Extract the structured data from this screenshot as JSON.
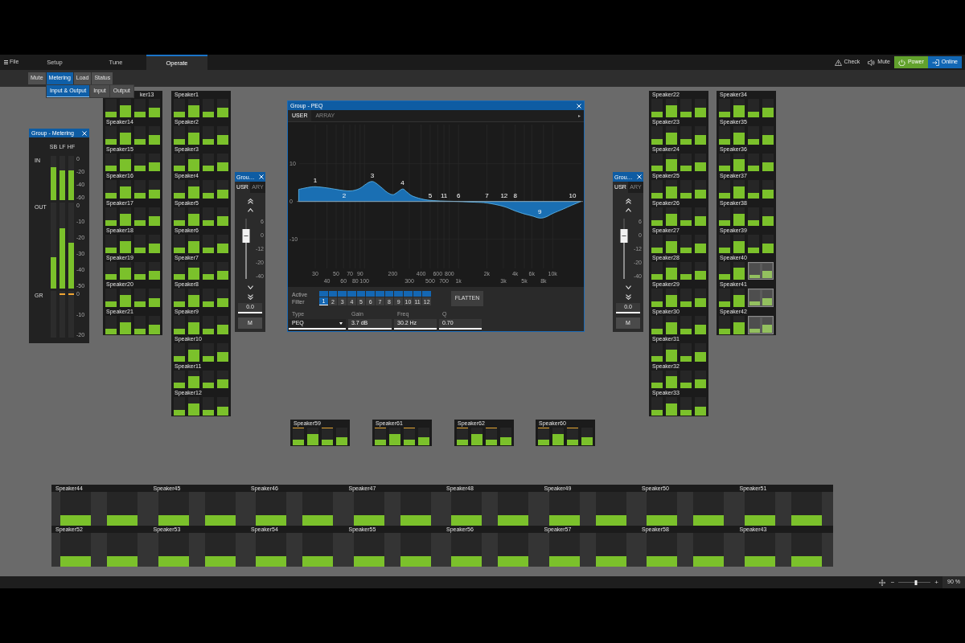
{
  "menu": {
    "file": "File",
    "tabs": [
      {
        "label": "Setup",
        "selected": false
      },
      {
        "label": "Tune",
        "selected": false
      },
      {
        "label": "Operate",
        "selected": true
      }
    ]
  },
  "top_actions": [
    {
      "kind": "check",
      "label": "Check",
      "on": false
    },
    {
      "kind": "mute",
      "label": "Mute",
      "on": false
    },
    {
      "kind": "power",
      "label": "Power",
      "on": true
    },
    {
      "kind": "online",
      "label": "Online",
      "on": true
    }
  ],
  "subtabs": [
    {
      "label": "Mute",
      "selected": false
    },
    {
      "label": "Metering",
      "selected": true
    },
    {
      "label": "Load",
      "selected": false
    },
    {
      "label": "Status",
      "selected": false
    }
  ],
  "submenu": [
    {
      "label": "Input & Output",
      "selected": true
    },
    {
      "label": "Input",
      "selected": false
    },
    {
      "label": "Output",
      "selected": false
    }
  ],
  "metering_window": {
    "title": "Group - Metering",
    "channels": [
      "SB",
      "LF",
      "HF"
    ],
    "rows": [
      {
        "label": "IN",
        "kind": "level",
        "scale": [
          "0",
          "-20",
          "-40",
          "-60"
        ],
        "meters": [
          {
            "level": 0.75
          },
          {
            "level": 0.67
          },
          {
            "level": 0.67
          }
        ]
      },
      {
        "label": "OUT",
        "kind": "level",
        "scale": [
          "0",
          "-10",
          "-20",
          "-30",
          "-40",
          "-50"
        ],
        "meters": [
          {
            "level": 0.36
          },
          {
            "level": 0.7
          },
          {
            "level": 0.53
          }
        ]
      },
      {
        "label": "GR",
        "kind": "reduction",
        "scale": [
          "0",
          "-10",
          "-20"
        ],
        "meters": [
          {
            "limiting": false
          },
          {
            "limiting": true
          },
          {
            "limiting": true
          }
        ]
      }
    ]
  },
  "speaker_groups": [
    {
      "kind": "column",
      "speakers": [
        {
          "name": "ker13",
          "meters": [
            {
              "level": 0.3
            },
            {
              "level": 0.65
            },
            {
              "level": 0.3
            },
            {
              "level": 0.5
            }
          ]
        },
        {
          "name": "Speaker14",
          "meters": [
            {
              "level": 0.3
            },
            {
              "level": 0.65
            },
            {
              "level": 0.3
            },
            {
              "level": 0.5
            }
          ]
        },
        {
          "name": "Speaker15",
          "meters": [
            {
              "level": 0.3
            },
            {
              "level": 0.65
            },
            {
              "level": 0.3
            },
            {
              "level": 0.5
            }
          ]
        },
        {
          "name": "Speaker16",
          "meters": [
            {
              "level": 0.3
            },
            {
              "level": 0.65
            },
            {
              "level": 0.3
            },
            {
              "level": 0.5
            }
          ]
        },
        {
          "name": "Speaker17",
          "meters": [
            {
              "level": 0.3
            },
            {
              "level": 0.65
            },
            {
              "level": 0.3
            },
            {
              "level": 0.5
            }
          ]
        },
        {
          "name": "Speaker18",
          "meters": [
            {
              "level": 0.3
            },
            {
              "level": 0.65
            },
            {
              "level": 0.3
            },
            {
              "level": 0.5
            }
          ]
        },
        {
          "name": "Speaker19",
          "meters": [
            {
              "level": 0.3
            },
            {
              "level": 0.65
            },
            {
              "level": 0.3
            },
            {
              "level": 0.5
            }
          ]
        },
        {
          "name": "Speaker20",
          "meters": [
            {
              "level": 0.3
            },
            {
              "level": 0.65
            },
            {
              "level": 0.3
            },
            {
              "level": 0.5
            }
          ]
        },
        {
          "name": "Speaker21",
          "meters": [
            {
              "level": 0.3
            },
            {
              "level": 0.65
            },
            {
              "level": 0.3
            },
            {
              "level": 0.5
            }
          ]
        }
      ]
    },
    {
      "kind": "column",
      "speakers": [
        {
          "name": "Speaker1",
          "meters": [
            {
              "level": 0.3
            },
            {
              "level": 0.65
            },
            {
              "level": 0.3
            },
            {
              "level": 0.5
            }
          ]
        },
        {
          "name": "Speaker2",
          "meters": [
            {
              "level": 0.3
            },
            {
              "level": 0.65
            },
            {
              "level": 0.3
            },
            {
              "level": 0.5
            }
          ]
        },
        {
          "name": "Speaker3",
          "meters": [
            {
              "level": 0.3
            },
            {
              "level": 0.65
            },
            {
              "level": 0.3
            },
            {
              "level": 0.5
            }
          ]
        },
        {
          "name": "Speaker4",
          "meters": [
            {
              "level": 0.3
            },
            {
              "level": 0.65
            },
            {
              "level": 0.3
            },
            {
              "level": 0.5
            }
          ]
        },
        {
          "name": "Speaker5",
          "meters": [
            {
              "level": 0.3
            },
            {
              "level": 0.65
            },
            {
              "level": 0.3
            },
            {
              "level": 0.5
            }
          ]
        },
        {
          "name": "Speaker6",
          "meters": [
            {
              "level": 0.3
            },
            {
              "level": 0.65
            },
            {
              "level": 0.3
            },
            {
              "level": 0.5
            }
          ]
        },
        {
          "name": "Speaker7",
          "meters": [
            {
              "level": 0.3
            },
            {
              "level": 0.65
            },
            {
              "level": 0.3
            },
            {
              "level": 0.5
            }
          ]
        },
        {
          "name": "Speaker8",
          "meters": [
            {
              "level": 0.3
            },
            {
              "level": 0.65
            },
            {
              "level": 0.3
            },
            {
              "level": 0.5
            }
          ]
        },
        {
          "name": "Speaker9",
          "meters": [
            {
              "level": 0.3
            },
            {
              "level": 0.65
            },
            {
              "level": 0.3
            },
            {
              "level": 0.5
            }
          ]
        },
        {
          "name": "Speaker10",
          "meters": [
            {
              "level": 0.3
            },
            {
              "level": 0.65
            },
            {
              "level": 0.3
            },
            {
              "level": 0.5
            }
          ]
        },
        {
          "name": "Speaker11",
          "meters": [
            {
              "level": 0.3
            },
            {
              "level": 0.65
            },
            {
              "level": 0.3
            },
            {
              "level": 0.5
            }
          ]
        },
        {
          "name": "Speaker12",
          "meters": [
            {
              "level": 0.3
            },
            {
              "level": 0.65
            },
            {
              "level": 0.3
            },
            {
              "level": 0.5
            }
          ]
        }
      ]
    },
    {
      "kind": "column",
      "speakers": [
        {
          "name": "Speaker22",
          "meters": [
            {
              "level": 0.3
            },
            {
              "level": 0.65
            },
            {
              "level": 0.3
            },
            {
              "level": 0.5
            }
          ]
        },
        {
          "name": "Speaker23",
          "meters": [
            {
              "level": 0.3
            },
            {
              "level": 0.65
            },
            {
              "level": 0.3
            },
            {
              "level": 0.5
            }
          ]
        },
        {
          "name": "Speaker24",
          "meters": [
            {
              "level": 0.3
            },
            {
              "level": 0.65
            },
            {
              "level": 0.3
            },
            {
              "level": 0.5
            }
          ]
        },
        {
          "name": "Speaker25",
          "meters": [
            {
              "level": 0.3
            },
            {
              "level": 0.65
            },
            {
              "level": 0.3
            },
            {
              "level": 0.5
            }
          ]
        },
        {
          "name": "Speaker26",
          "meters": [
            {
              "level": 0.3
            },
            {
              "level": 0.65
            },
            {
              "level": 0.3
            },
            {
              "level": 0.5
            }
          ]
        },
        {
          "name": "Speaker27",
          "meters": [
            {
              "level": 0.3
            },
            {
              "level": 0.65
            },
            {
              "level": 0.3
            },
            {
              "level": 0.5
            }
          ]
        },
        {
          "name": "Speaker28",
          "meters": [
            {
              "level": 0.3
            },
            {
              "level": 0.65
            },
            {
              "level": 0.3
            },
            {
              "level": 0.5
            }
          ]
        },
        {
          "name": "Speaker29",
          "meters": [
            {
              "level": 0.3
            },
            {
              "level": 0.65
            },
            {
              "level": 0.3
            },
            {
              "level": 0.5
            }
          ]
        },
        {
          "name": "Speaker30",
          "meters": [
            {
              "level": 0.3
            },
            {
              "level": 0.65
            },
            {
              "level": 0.3
            },
            {
              "level": 0.5
            }
          ]
        },
        {
          "name": "Speaker31",
          "meters": [
            {
              "level": 0.3
            },
            {
              "level": 0.65
            },
            {
              "level": 0.3
            },
            {
              "level": 0.5
            }
          ]
        },
        {
          "name": "Speaker32",
          "meters": [
            {
              "level": 0.3
            },
            {
              "level": 0.65
            },
            {
              "level": 0.3
            },
            {
              "level": 0.5
            }
          ]
        },
        {
          "name": "Speaker33",
          "meters": [
            {
              "level": 0.3
            },
            {
              "level": 0.65
            },
            {
              "level": 0.3
            },
            {
              "level": 0.5
            }
          ]
        }
      ]
    },
    {
      "kind": "column",
      "speakers": [
        {
          "name": "Speaker34",
          "kind": "standard",
          "meters": [
            {
              "level": 0.3
            },
            {
              "level": 0.65
            },
            {
              "level": 0.3
            },
            {
              "level": 0.5
            }
          ]
        },
        {
          "name": "Speaker35",
          "kind": "standard",
          "meters": [
            {
              "level": 0.3
            },
            {
              "level": 0.65
            },
            {
              "level": 0.3
            },
            {
              "level": 0.5
            }
          ]
        },
        {
          "name": "Speaker36",
          "kind": "standard",
          "meters": [
            {
              "level": 0.3
            },
            {
              "level": 0.65
            },
            {
              "level": 0.3
            },
            {
              "level": 0.5
            }
          ]
        },
        {
          "name": "Speaker37",
          "kind": "standard",
          "meters": [
            {
              "level": 0.3
            },
            {
              "level": 0.65
            },
            {
              "level": 0.3
            },
            {
              "level": 0.5
            }
          ]
        },
        {
          "name": "Speaker38",
          "kind": "standard",
          "meters": [
            {
              "level": 0.3
            },
            {
              "level": 0.65
            },
            {
              "level": 0.3
            },
            {
              "level": 0.5
            }
          ]
        },
        {
          "name": "Speaker39",
          "kind": "standard",
          "meters": [
            {
              "level": 0.3
            },
            {
              "level": 0.65
            },
            {
              "level": 0.3
            },
            {
              "level": 0.5
            }
          ]
        },
        {
          "name": "Speaker40",
          "kind": "split",
          "meters": [
            {
              "level": 0.3
            },
            {
              "level": 0.65
            },
            {
              "level": 0.25
            },
            {
              "level": 0.5
            }
          ]
        },
        {
          "name": "Speaker41",
          "kind": "split",
          "meters": [
            {
              "level": 0.3
            },
            {
              "level": 0.65
            },
            {
              "level": 0.25
            },
            {
              "level": 0.5
            }
          ]
        },
        {
          "name": "Speaker42",
          "kind": "split",
          "meters": [
            {
              "level": 0.3
            },
            {
              "level": 0.65
            },
            {
              "level": 0.25
            },
            {
              "level": 0.5
            }
          ]
        }
      ]
    },
    {
      "kind": "compact",
      "speakers": [
        {
          "name": "Speaker59",
          "meters": [
            {
              "level": 0.3,
              "peak": true
            },
            {
              "level": 0.65,
              "peak": false
            },
            {
              "level": 0.3,
              "peak": true
            },
            {
              "level": 0.45,
              "peak": false
            }
          ]
        }
      ]
    },
    {
      "kind": "compact",
      "speakers": [
        {
          "name": "Speaker61",
          "meters": [
            {
              "level": 0.3,
              "peak": true
            },
            {
              "level": 0.65,
              "peak": false
            },
            {
              "level": 0.3,
              "peak": true
            },
            {
              "level": 0.45,
              "peak": false
            }
          ]
        }
      ]
    },
    {
      "kind": "compact",
      "speakers": [
        {
          "name": "Speaker62",
          "meters": [
            {
              "level": 0.3,
              "peak": true
            },
            {
              "level": 0.65,
              "peak": false
            },
            {
              "level": 0.3,
              "peak": true
            },
            {
              "level": 0.45,
              "peak": false
            }
          ]
        }
      ]
    },
    {
      "kind": "compact",
      "speakers": [
        {
          "name": "Speaker60",
          "meters": [
            {
              "level": 0.3,
              "peak": true
            },
            {
              "level": 0.65,
              "peak": false
            },
            {
              "level": 0.3,
              "peak": true
            },
            {
              "level": 0.45,
              "peak": false
            }
          ]
        }
      ]
    },
    {
      "kind": "wide",
      "speakers": [
        {
          "name": "Speaker44",
          "meters": [
            {
              "level": 0.32
            },
            {
              "level": 0.32
            }
          ]
        },
        {
          "name": "Speaker45",
          "meters": [
            {
              "level": 0.32
            },
            {
              "level": 0.32
            }
          ]
        },
        {
          "name": "Speaker46",
          "meters": [
            {
              "level": 0.32
            },
            {
              "level": 0.32
            }
          ]
        },
        {
          "name": "Speaker47",
          "meters": [
            {
              "level": 0.32
            },
            {
              "level": 0.32
            }
          ]
        },
        {
          "name": "Speaker48",
          "meters": [
            {
              "level": 0.32
            },
            {
              "level": 0.32
            }
          ]
        },
        {
          "name": "Speaker49",
          "meters": [
            {
              "level": 0.32
            },
            {
              "level": 0.32
            }
          ]
        },
        {
          "name": "Speaker50",
          "meters": [
            {
              "level": 0.32
            },
            {
              "level": 0.32
            }
          ]
        },
        {
          "name": "Speaker51",
          "meters": [
            {
              "level": 0.32
            },
            {
              "level": 0.32
            }
          ]
        },
        {
          "name": "Speaker52",
          "meters": [
            {
              "level": 0.32
            },
            {
              "level": 0.32
            }
          ]
        },
        {
          "name": "Speaker53",
          "meters": [
            {
              "level": 0.32
            },
            {
              "level": 0.32
            }
          ]
        },
        {
          "name": "Speaker54",
          "meters": [
            {
              "level": 0.32
            },
            {
              "level": 0.32
            }
          ]
        },
        {
          "name": "Speaker55",
          "meters": [
            {
              "level": 0.32
            },
            {
              "level": 0.32
            }
          ]
        },
        {
          "name": "Speaker56",
          "meters": [
            {
              "level": 0.32
            },
            {
              "level": 0.32
            }
          ]
        },
        {
          "name": "Speaker57",
          "meters": [
            {
              "level": 0.32
            },
            {
              "level": 0.32
            }
          ]
        },
        {
          "name": "Speaker58",
          "meters": [
            {
              "level": 0.32
            },
            {
              "level": 0.32
            }
          ]
        },
        {
          "name": "Speaker43",
          "meters": [
            {
              "level": 0.32
            },
            {
              "level": 0.32
            }
          ]
        }
      ]
    }
  ],
  "fader_windows": [
    {
      "title": "Grou…",
      "tabs": [
        {
          "label": "USR",
          "selected": true
        },
        {
          "label": "ARY",
          "selected": false
        }
      ],
      "fader": {
        "level": 0.71,
        "scale": [
          "6",
          "0",
          "-12",
          "-20",
          "-40"
        ]
      },
      "value": "0.0",
      "mute": "M"
    },
    {
      "title": "Grou…",
      "tabs": [
        {
          "label": "USR",
          "selected": true
        },
        {
          "label": "ARY",
          "selected": false
        }
      ],
      "fader": {
        "level": 0.71,
        "scale": [
          "6",
          "0",
          "-12",
          "-20",
          "-40"
        ]
      },
      "value": "0.0",
      "mute": "M"
    }
  ],
  "peq_window": {
    "title": "Group - PEQ",
    "tabs": [
      {
        "label": "USER",
        "selected": true
      },
      {
        "label": "ARRAY",
        "selected": false
      }
    ],
    "graph": {
      "gain_labels": [
        "10",
        "0",
        "-10"
      ],
      "freq_labels": [
        "30",
        "40",
        "50",
        "60",
        "70",
        "80",
        "90",
        "100",
        "200",
        "300",
        "400",
        "500",
        "600",
        "700",
        "800",
        "1k",
        "2k",
        "3k",
        "4k",
        "5k",
        "6k",
        "8k",
        "10k"
      ],
      "band_labels": [
        "1",
        "2",
        "3",
        "4",
        "5",
        "11",
        "6",
        "7",
        "12",
        "8",
        "9",
        "10"
      ]
    },
    "active_label": "Active",
    "filter_label": "Filter",
    "filters": [
      {
        "label": "1",
        "active": true,
        "selected": true
      },
      {
        "label": "2",
        "active": true,
        "selected": false
      },
      {
        "label": "3",
        "active": true,
        "selected": false
      },
      {
        "label": "4",
        "active": true,
        "selected": false
      },
      {
        "label": "5",
        "active": true,
        "selected": false
      },
      {
        "label": "6",
        "active": true,
        "selected": false
      },
      {
        "label": "7",
        "active": true,
        "selected": false
      },
      {
        "label": "8",
        "active": true,
        "selected": false
      },
      {
        "label": "9",
        "active": true,
        "selected": false
      },
      {
        "label": "10",
        "active": true,
        "selected": false
      },
      {
        "label": "11",
        "active": true,
        "selected": false
      },
      {
        "label": "12",
        "active": true,
        "selected": false
      }
    ],
    "flatten": "FLATTEN",
    "fields": [
      {
        "kind": "dropdown",
        "label": "Type",
        "value": "PEQ"
      },
      {
        "kind": "input",
        "label": "Gain",
        "value": "3.7 dB"
      },
      {
        "kind": "input",
        "label": "Freq",
        "value": "30.2 Hz"
      },
      {
        "kind": "input",
        "label": "Q",
        "value": "0.70"
      }
    ]
  },
  "status_bar": {
    "zoom_out": "−",
    "zoom": {
      "level": 0.55
    },
    "zoom_in": "+",
    "zoom_readout": "90 %"
  }
}
